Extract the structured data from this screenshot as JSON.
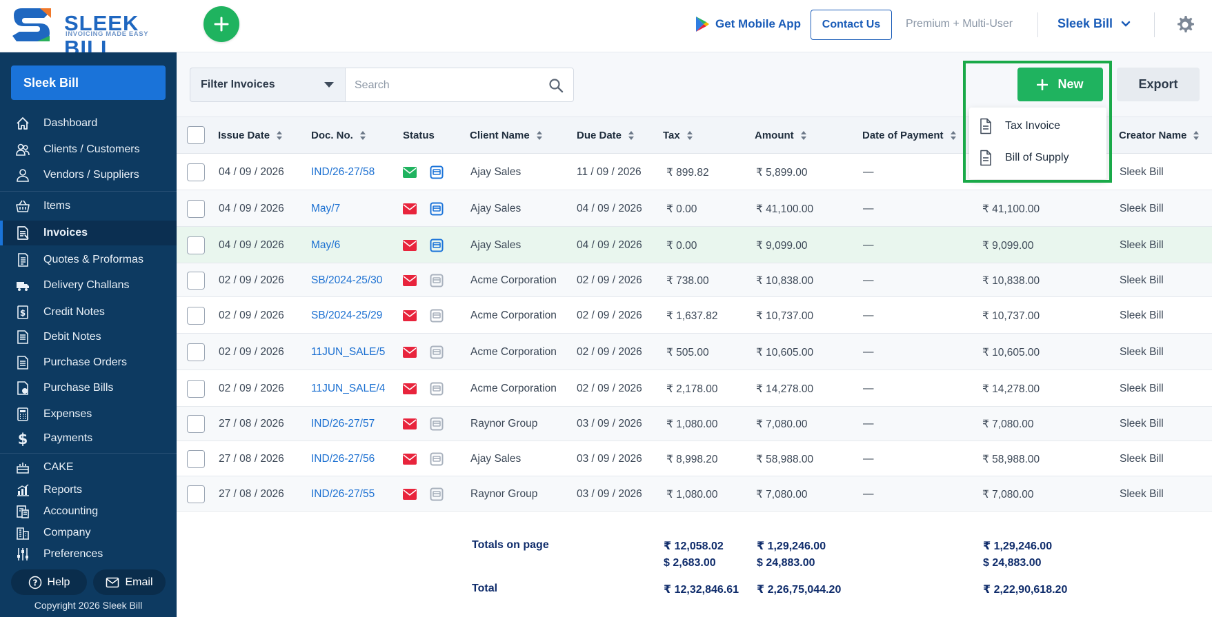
{
  "brand": {
    "name": "SLEEK BILL",
    "tagline": "INVOICING MADE EASY"
  },
  "header": {
    "get_app_label": "Get Mobile App",
    "contact_label": "Contact Us",
    "plan_label": "Premium + Multi-User",
    "account_label": "Sleek Bill"
  },
  "sidebar": {
    "company": "Sleek Bill",
    "items": [
      {
        "label": "Dashboard",
        "icon": "home-icon"
      },
      {
        "label": "Clients / Customers",
        "icon": "users-icon"
      },
      {
        "label": "Vendors / Suppliers",
        "icon": "user-icon"
      },
      {
        "label": "Items",
        "icon": "basket-icon"
      },
      {
        "label": "Invoices",
        "icon": "invoice-icon"
      },
      {
        "label": "Quotes & Proformas",
        "icon": "quote-icon"
      },
      {
        "label": "Delivery Challans",
        "icon": "truck-icon"
      },
      {
        "label": "Credit Notes",
        "icon": "credit-note-icon"
      },
      {
        "label": "Debit Notes",
        "icon": "debit-note-icon"
      },
      {
        "label": "Purchase Orders",
        "icon": "purchase-order-icon"
      },
      {
        "label": "Purchase Bills",
        "icon": "purchase-bill-icon"
      },
      {
        "label": "Expenses",
        "icon": "calculator-icon"
      },
      {
        "label": "Payments",
        "icon": "dollar-icon"
      },
      {
        "label": "CAKE",
        "icon": "cake-icon"
      },
      {
        "label": "Reports",
        "icon": "chart-icon"
      },
      {
        "label": "Accounting",
        "icon": "accounting-icon"
      },
      {
        "label": "Company",
        "icon": "building-icon"
      },
      {
        "label": "Preferences",
        "icon": "sliders-icon"
      }
    ],
    "active": "Invoices",
    "help_label": "Help",
    "email_label": "Email",
    "copyright": "Copyright 2026 Sleek Bill"
  },
  "toolbar": {
    "filter_label": "Filter Invoices",
    "search_placeholder": "Search",
    "new_label": "New",
    "export_label": "Export"
  },
  "new_menu": {
    "items": [
      "Tax Invoice",
      "Bill of Supply"
    ]
  },
  "table": {
    "headers": {
      "issue_date": "Issue Date",
      "doc_no": "Doc. No.",
      "status": "Status",
      "client": "Client Name",
      "due_date": "Due Date",
      "tax": "Tax",
      "amount": "Amount",
      "date_of_payment": "Date of Payment",
      "creator": "Creator Name"
    },
    "rows": [
      {
        "issue_date": "04 / 09 / 2026",
        "doc_no": "IND/26-27/58",
        "mail": "sent",
        "payment": "paid",
        "client": "Ajay Sales",
        "due_date": "11 / 09 / 2026",
        "tax": "₹ 899.82",
        "amount": "₹ 5,899.00",
        "date_of_payment": "—",
        "balance": "",
        "creator": "Sleek Bill"
      },
      {
        "issue_date": "04 / 09 / 2026",
        "doc_no": "May/7",
        "mail": "unsent",
        "payment": "paid",
        "client": "Ajay Sales",
        "due_date": "04 / 09 / 2026",
        "tax": "₹ 0.00",
        "amount": "₹ 41,100.00",
        "date_of_payment": "—",
        "balance": "₹ 41,100.00",
        "creator": "Sleek Bill"
      },
      {
        "issue_date": "04 / 09 / 2026",
        "doc_no": "May/6",
        "mail": "unsent",
        "payment": "paid",
        "client": "Ajay Sales",
        "due_date": "04 / 09 / 2026",
        "tax": "₹ 0.00",
        "amount": "₹ 9,099.00",
        "date_of_payment": "—",
        "balance": "₹ 9,099.00",
        "creator": "Sleek Bill"
      },
      {
        "issue_date": "02 / 09 / 2026",
        "doc_no": "SB/2024-25/30",
        "mail": "unsent",
        "payment": "unpaid",
        "client": "Acme Corporation",
        "due_date": "02 / 09 / 2026",
        "tax": "₹ 738.00",
        "amount": "₹ 10,838.00",
        "date_of_payment": "—",
        "balance": "₹ 10,838.00",
        "creator": "Sleek Bill"
      },
      {
        "issue_date": "02 / 09 / 2026",
        "doc_no": "SB/2024-25/29",
        "mail": "unsent",
        "payment": "unpaid",
        "client": "Acme Corporation",
        "due_date": "02 / 09 / 2026",
        "tax": "₹ 1,637.82",
        "amount": "₹ 10,737.00",
        "date_of_payment": "—",
        "balance": "₹ 10,737.00",
        "creator": "Sleek Bill"
      },
      {
        "issue_date": "02 / 09 / 2026",
        "doc_no": "11JUN_SALE/5",
        "mail": "unsent",
        "payment": "unpaid",
        "client": "Acme Corporation",
        "due_date": "02 / 09 / 2026",
        "tax": "₹ 505.00",
        "amount": "₹ 10,605.00",
        "date_of_payment": "—",
        "balance": "₹ 10,605.00",
        "creator": "Sleek Bill"
      },
      {
        "issue_date": "02 / 09 / 2026",
        "doc_no": "11JUN_SALE/4",
        "mail": "unsent",
        "payment": "unpaid",
        "client": "Acme Corporation",
        "due_date": "02 / 09 / 2026",
        "tax": "₹ 2,178.00",
        "amount": "₹ 14,278.00",
        "date_of_payment": "—",
        "balance": "₹ 14,278.00",
        "creator": "Sleek Bill"
      },
      {
        "issue_date": "27 / 08 / 2026",
        "doc_no": "IND/26-27/57",
        "mail": "unsent",
        "payment": "unpaid",
        "client": "Raynor Group",
        "due_date": "03 / 09 / 2026",
        "tax": "₹ 1,080.00",
        "amount": "₹ 7,080.00",
        "date_of_payment": "—",
        "balance": "₹ 7,080.00",
        "creator": "Sleek Bill"
      },
      {
        "issue_date": "27 / 08 / 2026",
        "doc_no": "IND/26-27/56",
        "mail": "unsent",
        "payment": "unpaid",
        "client": "Ajay Sales",
        "due_date": "03 / 09 / 2026",
        "tax": "₹ 8,998.20",
        "amount": "₹ 58,988.00",
        "date_of_payment": "—",
        "balance": "₹ 58,988.00",
        "creator": "Sleek Bill"
      },
      {
        "issue_date": "27 / 08 / 2026",
        "doc_no": "IND/26-27/55",
        "mail": "unsent",
        "payment": "unpaid",
        "client": "Raynor Group",
        "due_date": "03 / 09 / 2026",
        "tax": "₹ 1,080.00",
        "amount": "₹ 7,080.00",
        "date_of_payment": "—",
        "balance": "₹ 7,080.00",
        "creator": "Sleek Bill"
      }
    ]
  },
  "totals": {
    "page_label": "Totals on page",
    "page_tax_inr": "₹ 12,058.02",
    "page_tax_usd": "$ 2,683.00",
    "page_amount_inr": "₹ 1,29,246.00",
    "page_amount_usd": "$ 24,883.00",
    "page_balance_inr": "₹ 1,29,246.00",
    "page_balance_usd": "$ 24,883.00",
    "total_label": "Total",
    "total_tax": "₹ 12,32,846.61",
    "total_amount": "₹ 2,26,75,044.20",
    "total_balance": "₹ 2,22,90,618.20"
  },
  "colors": {
    "accent": "#1a73d9",
    "success": "#1fb35f",
    "sidebar": "#0d3a61",
    "danger": "#e8243c",
    "highlight": "#19a948"
  }
}
